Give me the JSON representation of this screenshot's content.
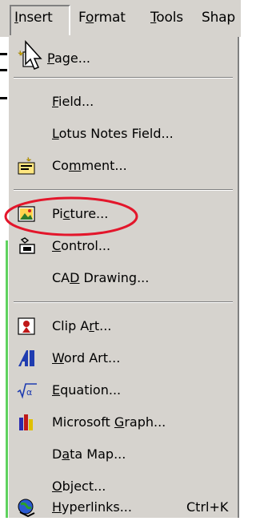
{
  "menubar": {
    "items": [
      {
        "key": "insert",
        "pre": "",
        "ul": "I",
        "post": "nsert"
      },
      {
        "key": "format",
        "pre": "F",
        "ul": "o",
        "post": "rmat"
      },
      {
        "key": "tools",
        "pre": "",
        "ul": "T",
        "post": "ools"
      },
      {
        "key": "shape",
        "pre": "Shap",
        "ul": "",
        "post": ""
      }
    ]
  },
  "menu": {
    "items": [
      {
        "key": "page",
        "icon": "new-page-icon",
        "pre": "",
        "ul": "P",
        "post": "age...",
        "shortcut": ""
      },
      {
        "key": "field",
        "icon": "",
        "pre": "",
        "ul": "F",
        "post": "ield...",
        "shortcut": ""
      },
      {
        "key": "lotus",
        "icon": "",
        "pre": "",
        "ul": "L",
        "post": "otus Notes Field...",
        "shortcut": ""
      },
      {
        "key": "comment",
        "icon": "comment-icon",
        "pre": "Co",
        "ul": "m",
        "post": "ment...",
        "shortcut": ""
      },
      {
        "key": "picture",
        "icon": "picture-icon",
        "pre": "Pi",
        "ul": "c",
        "post": "ture...",
        "shortcut": ""
      },
      {
        "key": "control",
        "icon": "control-icon",
        "pre": "",
        "ul": "C",
        "post": "ontrol...",
        "shortcut": ""
      },
      {
        "key": "cad",
        "icon": "",
        "pre": "CA",
        "ul": "D",
        "post": " Drawing...",
        "shortcut": ""
      },
      {
        "key": "clipart",
        "icon": "clip-art-icon",
        "pre": "Clip A",
        "ul": "r",
        "post": "t...",
        "shortcut": ""
      },
      {
        "key": "wordart",
        "icon": "word-art-icon",
        "pre": "",
        "ul": "W",
        "post": "ord Art...",
        "shortcut": ""
      },
      {
        "key": "equation",
        "icon": "equation-icon",
        "pre": "",
        "ul": "E",
        "post": "quation...",
        "shortcut": ""
      },
      {
        "key": "graph",
        "icon": "graph-icon",
        "pre": "Microsoft ",
        "ul": "G",
        "post": "raph...",
        "shortcut": ""
      },
      {
        "key": "datamap",
        "icon": "",
        "pre": "D",
        "ul": "a",
        "post": "ta Map...",
        "shortcut": ""
      },
      {
        "key": "object",
        "icon": "",
        "pre": "",
        "ul": "O",
        "post": "bject...",
        "shortcut": ""
      },
      {
        "key": "hyperlinks",
        "icon": "globe-link-icon",
        "pre": "",
        "ul": "H",
        "post": "yperlinks...",
        "shortcut": "Ctrl+K"
      }
    ]
  },
  "colors": {
    "menu_bg": "#d6d3ce",
    "highlight_oval": "#e3162b",
    "green_strip": "#5fd25f"
  }
}
